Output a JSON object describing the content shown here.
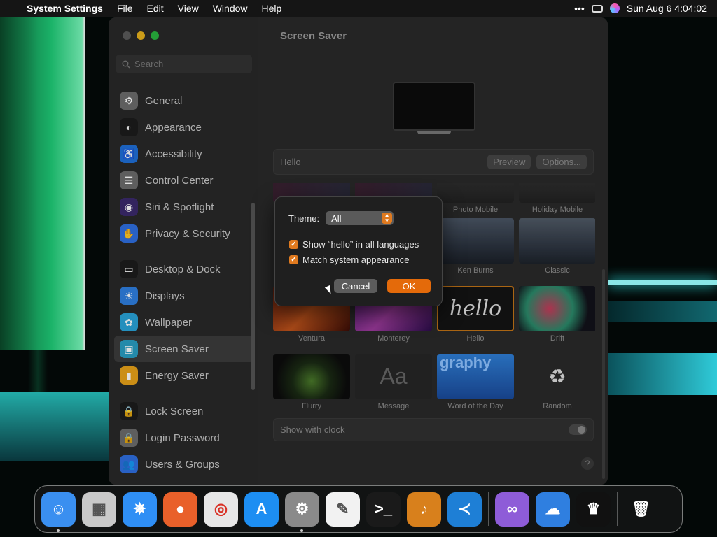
{
  "menubar": {
    "app_name": "System Settings",
    "menus": [
      "File",
      "Edit",
      "View",
      "Window",
      "Help"
    ],
    "datetime": "Sun Aug 6  4:04:02"
  },
  "sidebar": {
    "search_placeholder": "Search",
    "items": [
      {
        "label": "General",
        "icon": "gear-icon",
        "color": "#6b6b6b"
      },
      {
        "label": "Appearance",
        "icon": "appearance-icon",
        "color": "#1c1c1c"
      },
      {
        "label": "Accessibility",
        "icon": "accessibility-icon",
        "color": "#1f6fd6"
      },
      {
        "label": "Control Center",
        "icon": "control-center-icon",
        "color": "#6b6b6b"
      },
      {
        "label": "Siri & Spotlight",
        "icon": "siri-icon",
        "color": "#3b2a6b"
      },
      {
        "label": "Privacy & Security",
        "icon": "hand-icon",
        "color": "#2f6fe0"
      },
      {
        "label": "Desktop & Dock",
        "icon": "desktop-dock-icon",
        "color": "#1c1c1c"
      },
      {
        "label": "Displays",
        "icon": "displays-icon",
        "color": "#2f7fe0"
      },
      {
        "label": "Wallpaper",
        "icon": "wallpaper-icon",
        "color": "#2aa3d8"
      },
      {
        "label": "Screen Saver",
        "icon": "screen-saver-icon",
        "color": "#2a9ec2"
      },
      {
        "label": "Energy Saver",
        "icon": "battery-icon",
        "color": "#e8a21a"
      },
      {
        "label": "Lock Screen",
        "icon": "lock-icon",
        "color": "#1c1c1c"
      },
      {
        "label": "Login Password",
        "icon": "lock-icon",
        "color": "#6b6b6b"
      },
      {
        "label": "Users & Groups",
        "icon": "users-icon",
        "color": "#2f6fe0"
      }
    ]
  },
  "main": {
    "title": "Screen Saver",
    "hello_bar": {
      "label": "Hello",
      "preview_button": "Preview",
      "options_button": "Options..."
    },
    "tiles": [
      {
        "label": "",
        "row": 0,
        "col": 0
      },
      {
        "label": "",
        "row": 0,
        "col": 1
      },
      {
        "label": "Photo Mobile",
        "row": 0,
        "col": 2
      },
      {
        "label": "Holiday Mobile",
        "row": 0,
        "col": 3
      },
      {
        "label": "Ken Burns",
        "row": 1,
        "col": 2
      },
      {
        "label": "Classic",
        "row": 1,
        "col": 3
      },
      {
        "label": "Ventura",
        "row": 2,
        "col": 0
      },
      {
        "label": "Monterey",
        "row": 2,
        "col": 1
      },
      {
        "label": "Hello",
        "row": 2,
        "col": 2,
        "selected": true,
        "thumb_text": "hello"
      },
      {
        "label": "Drift",
        "row": 2,
        "col": 3
      },
      {
        "label": "Flurry",
        "row": 3,
        "col": 0
      },
      {
        "label": "Message",
        "row": 3,
        "col": 1,
        "thumb_text": "Aa"
      },
      {
        "label": "Word of the Day",
        "row": 3,
        "col": 2,
        "thumb_text": "graphy"
      },
      {
        "label": "Random",
        "row": 3,
        "col": 3
      }
    ],
    "show_with_clock": {
      "label": "Show with clock",
      "enabled": false
    },
    "help_label": "?"
  },
  "sheet": {
    "theme_label": "Theme:",
    "theme_value": "All",
    "checkbox_languages": {
      "label": "Show “hello” in all languages",
      "checked": true
    },
    "checkbox_match": {
      "label": "Match system appearance",
      "checked": true
    },
    "cancel_label": "Cancel",
    "ok_label": "OK"
  },
  "dock": {
    "apps": [
      {
        "name": "finder-icon",
        "color": "#3a8ff0",
        "running": true
      },
      {
        "name": "launchpad-icon",
        "color": "#c9c9c9",
        "running": false
      },
      {
        "name": "safari-icon",
        "color": "#2f8ff5",
        "running": false
      },
      {
        "name": "firefox-icon",
        "color": "#e9602a",
        "running": false
      },
      {
        "name": "chrome-icon",
        "color": "#e7e7e7",
        "running": false
      },
      {
        "name": "app-store-icon",
        "color": "#1d8ef2",
        "running": false
      },
      {
        "name": "system-settings-icon",
        "color": "#8a8a8a",
        "running": true
      },
      {
        "name": "textedit-icon",
        "color": "#f2f2f2",
        "running": false
      },
      {
        "name": "terminal-icon",
        "color": "#1a1a1a",
        "running": false
      },
      {
        "name": "garageband-icon",
        "color": "#d8801c",
        "running": false
      },
      {
        "name": "vscode-icon",
        "color": "#1e7fd6",
        "running": false
      },
      {
        "name": "visual-studio-icon",
        "color": "#8e5cd8",
        "running": false
      },
      {
        "name": "weather-icon",
        "color": "#2f7fe0",
        "running": false
      },
      {
        "name": "butler-icon",
        "color": "#111111",
        "running": false
      },
      {
        "name": "trash-icon",
        "color": "#9a9a9a",
        "running": false
      }
    ]
  }
}
